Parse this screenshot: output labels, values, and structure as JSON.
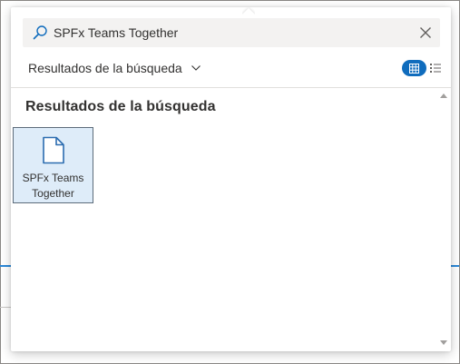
{
  "search": {
    "value": "SPFx Teams Together",
    "placeholder": ""
  },
  "scope": {
    "label": "Resultados de la búsqueda"
  },
  "view_toggle": {
    "selected": "grid",
    "icons": [
      "grid-icon",
      "list-icon"
    ]
  },
  "results": {
    "title": "Resultados de la búsqueda",
    "items": [
      {
        "label": "SPFx Teams Together",
        "icon": "document-icon",
        "selected": true
      }
    ]
  },
  "colors": {
    "accent": "#0f6cbd",
    "tile_selected_bg": "#deecf9",
    "search_bg": "#f3f2f1",
    "text": "#323130"
  }
}
